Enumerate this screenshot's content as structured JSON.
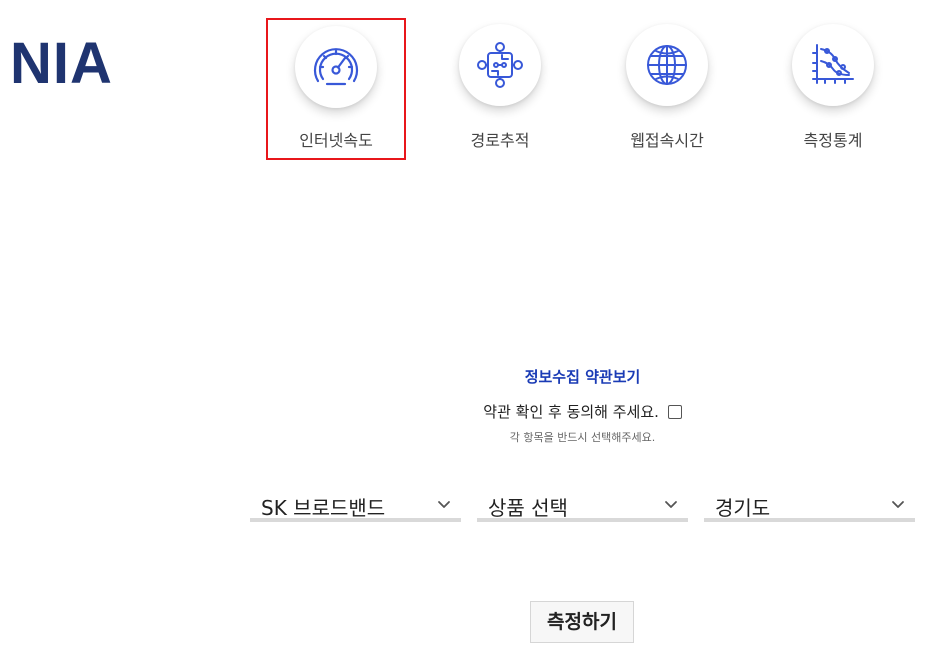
{
  "logo": {
    "text": "NIA",
    "color": "#1f3470"
  },
  "nav": {
    "items": [
      {
        "label": "인터넷속도",
        "icon": "speedometer-icon",
        "selected": true
      },
      {
        "label": "경로추적",
        "icon": "route-trace-icon",
        "selected": false
      },
      {
        "label": "웹접속시간",
        "icon": "globe-icon",
        "selected": false
      },
      {
        "label": "측정통계",
        "icon": "statistics-chart-icon",
        "selected": false
      }
    ],
    "accent_color": "#3858d8",
    "selected_border_color": "#e8161b"
  },
  "terms": {
    "link_label": "정보수집 약관보기",
    "agree_label": "약관 확인 후 동의해 주세요.",
    "agree_checked": false,
    "hint": "각 항목을 반드시 선택해주세요.",
    "link_color": "#1a3bb5"
  },
  "selects": {
    "isp": {
      "value": "SK 브로드밴드"
    },
    "product": {
      "value": "상품 선택"
    },
    "region": {
      "value": "경기도"
    }
  },
  "actions": {
    "measure_label": "측정하기"
  }
}
